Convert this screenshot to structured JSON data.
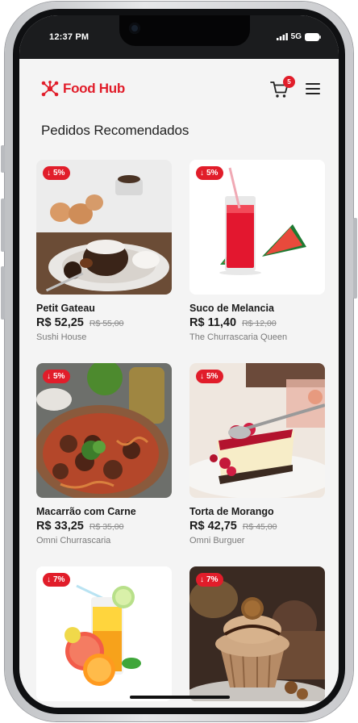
{
  "status_bar": {
    "time": "12:37 PM",
    "network": "5G"
  },
  "header": {
    "app_name": "Food Hub",
    "cart_count": "5",
    "logo_icon": "network-nodes-icon",
    "cart_icon": "shopping-cart-icon",
    "menu_icon": "hamburger-menu-icon"
  },
  "section_title": "Pedidos Recomendados",
  "colors": {
    "brand": "#e11d2a",
    "text": "#1b1b1b",
    "muted": "#7a7a7a",
    "background": "#f4f4f4"
  },
  "products": [
    {
      "name": "Petit Gateau",
      "price": "R$ 52,25",
      "old_price": "R$ 55,00",
      "restaurant": "Sushi House",
      "discount": "5%"
    },
    {
      "name": "Suco de Melancia",
      "price": "R$ 11,40",
      "old_price": "R$ 12,00",
      "restaurant": "The Churrascaria Queen",
      "discount": "5%"
    },
    {
      "name": "Macarrão com Carne",
      "price": "R$ 33,25",
      "old_price": "R$ 35,00",
      "restaurant": "Omni Churrascaria",
      "discount": "5%"
    },
    {
      "name": "Torta de Morango",
      "price": "R$ 42,75",
      "old_price": "R$ 45,00",
      "restaurant": "Omni Burguer",
      "discount": "5%"
    },
    {
      "name": "",
      "price": "",
      "old_price": "",
      "restaurant": "",
      "discount": "7%"
    },
    {
      "name": "",
      "price": "",
      "old_price": "",
      "restaurant": "",
      "discount": "7%"
    }
  ]
}
